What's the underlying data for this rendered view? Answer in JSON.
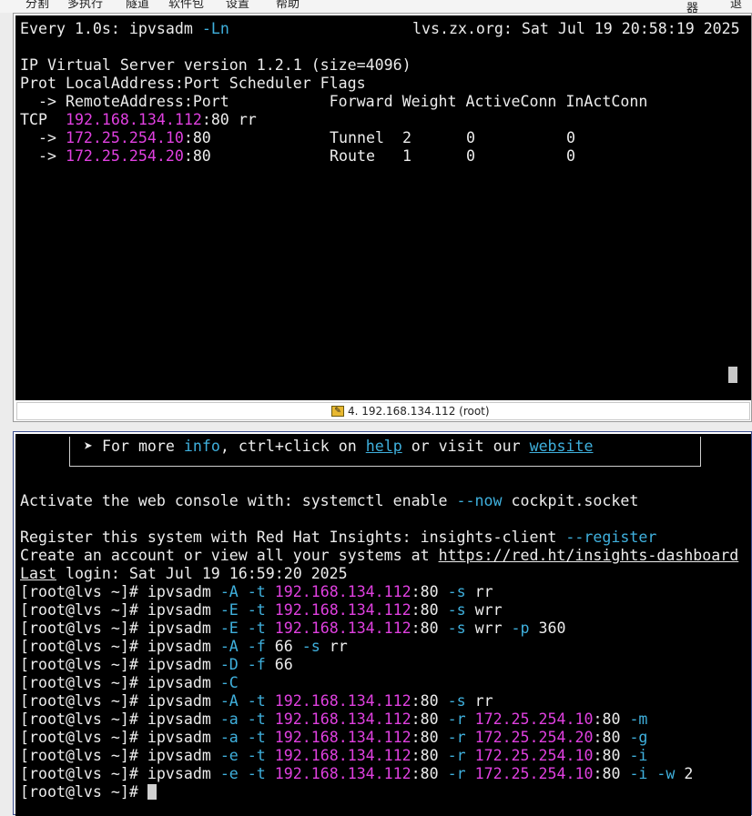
{
  "menubar": {
    "items": [
      "分割",
      "多执行",
      "隧道",
      "软件包",
      "设置",
      "帮助",
      "器",
      "退出"
    ]
  },
  "top_terminal": {
    "watch_header_left": "Every 1.0s: ipvsadm -Ln",
    "watch_cmd": "ipvsadm",
    "watch_flag": "-Ln",
    "watch_interval": "Every 1.0s:",
    "watch_header_right": "lvs.zx.org: Sat Jul 19 20:58:19 2025",
    "version_line": "IP Virtual Server version 1.2.1 (size=4096)",
    "header1": "Prot LocalAddress:Port Scheduler Flags",
    "header2": "  -> RemoteAddress:Port           Forward Weight ActiveConn InActConn",
    "service": {
      "prot": "TCP",
      "ip": "192.168.134.112",
      "port": ":80",
      "scheduler": "rr"
    },
    "real_servers": [
      {
        "arrow": "  -> ",
        "ip": "172.25.254.10",
        "port": ":80",
        "forward": "Tunnel",
        "weight": "2",
        "active": "0",
        "inact": "0"
      },
      {
        "arrow": "  -> ",
        "ip": "172.25.254.20",
        "port": ":80",
        "forward": "Route",
        "weight": "1",
        "active": "0",
        "inact": "0"
      }
    ]
  },
  "tab": {
    "label": "4. 192.168.134.112 (root)"
  },
  "bottom_terminal": {
    "box_line_prefix": "➤ For more ",
    "box_info": "info",
    "box_mid": ", ctrl+click on ",
    "box_help": "help",
    "box_or": " or visit our ",
    "box_website": "website",
    "activate_prefix": "Activate the web console with: systemctl enable ",
    "activate_flag": "--now",
    "activate_suffix": " cockpit.socket",
    "register_prefix": "Register this system with Red Hat Insights: insights-client ",
    "register_flag": "--register",
    "account_prefix": "Create an account or view all your systems at ",
    "account_url": "https://red.ht/insights-dashboard",
    "last_word": "Last",
    "last_rest": " login: Sat Jul 19 16:59:20 2025",
    "prompt": "[root@lvs ~]# ",
    "commands": [
      [
        [
          "k",
          "ipvsadm "
        ],
        [
          "c",
          "-A"
        ],
        [
          "k",
          " "
        ],
        [
          "c",
          "-t"
        ],
        [
          "k",
          " "
        ],
        [
          "m",
          "192.168.134.112"
        ],
        [
          "k",
          ":80 "
        ],
        [
          "c",
          "-s"
        ],
        [
          "k",
          " rr"
        ]
      ],
      [
        [
          "k",
          "ipvsadm "
        ],
        [
          "c",
          "-E"
        ],
        [
          "k",
          " "
        ],
        [
          "c",
          "-t"
        ],
        [
          "k",
          " "
        ],
        [
          "m",
          "192.168.134.112"
        ],
        [
          "k",
          ":80 "
        ],
        [
          "c",
          "-s"
        ],
        [
          "k",
          " wrr"
        ]
      ],
      [
        [
          "k",
          "ipvsadm "
        ],
        [
          "c",
          "-E"
        ],
        [
          "k",
          " "
        ],
        [
          "c",
          "-t"
        ],
        [
          "k",
          " "
        ],
        [
          "m",
          "192.168.134.112"
        ],
        [
          "k",
          ":80 "
        ],
        [
          "c",
          "-s"
        ],
        [
          "k",
          " wrr "
        ],
        [
          "c",
          "-p"
        ],
        [
          "k",
          " 360"
        ]
      ],
      [
        [
          "k",
          "ipvsadm "
        ],
        [
          "c",
          "-A"
        ],
        [
          "k",
          " "
        ],
        [
          "c",
          "-f"
        ],
        [
          "k",
          " 66 "
        ],
        [
          "c",
          "-s"
        ],
        [
          "k",
          " rr"
        ]
      ],
      [
        [
          "k",
          "ipvsadm "
        ],
        [
          "c",
          "-D"
        ],
        [
          "k",
          " "
        ],
        [
          "c",
          "-f"
        ],
        [
          "k",
          " 66"
        ]
      ],
      [
        [
          "k",
          "ipvsadm "
        ],
        [
          "c",
          "-C"
        ]
      ],
      [
        [
          "k",
          "ipvsadm "
        ],
        [
          "c",
          "-A"
        ],
        [
          "k",
          " "
        ],
        [
          "c",
          "-t"
        ],
        [
          "k",
          " "
        ],
        [
          "m",
          "192.168.134.112"
        ],
        [
          "k",
          ":80 "
        ],
        [
          "c",
          "-s"
        ],
        [
          "k",
          " rr"
        ]
      ],
      [
        [
          "k",
          "ipvsadm "
        ],
        [
          "c",
          "-a"
        ],
        [
          "k",
          " "
        ],
        [
          "c",
          "-t"
        ],
        [
          "k",
          " "
        ],
        [
          "m",
          "192.168.134.112"
        ],
        [
          "k",
          ":80 "
        ],
        [
          "c",
          "-r"
        ],
        [
          "k",
          " "
        ],
        [
          "m",
          "172.25.254.10"
        ],
        [
          "k",
          ":80 "
        ],
        [
          "c",
          "-m"
        ]
      ],
      [
        [
          "k",
          "ipvsadm "
        ],
        [
          "c",
          "-a"
        ],
        [
          "k",
          " "
        ],
        [
          "c",
          "-t"
        ],
        [
          "k",
          " "
        ],
        [
          "m",
          "192.168.134.112"
        ],
        [
          "k",
          ":80 "
        ],
        [
          "c",
          "-r"
        ],
        [
          "k",
          " "
        ],
        [
          "m",
          "172.25.254.20"
        ],
        [
          "k",
          ":80 "
        ],
        [
          "c",
          "-g"
        ]
      ],
      [
        [
          "k",
          "ipvsadm "
        ],
        [
          "c",
          "-e"
        ],
        [
          "k",
          " "
        ],
        [
          "c",
          "-t"
        ],
        [
          "k",
          " "
        ],
        [
          "m",
          "192.168.134.112"
        ],
        [
          "k",
          ":80 "
        ],
        [
          "c",
          "-r"
        ],
        [
          "k",
          " "
        ],
        [
          "m",
          "172.25.254.10"
        ],
        [
          "k",
          ":80 "
        ],
        [
          "c",
          "-i"
        ]
      ],
      [
        [
          "k",
          "ipvsadm "
        ],
        [
          "c",
          "-e"
        ],
        [
          "k",
          " "
        ],
        [
          "c",
          "-t"
        ],
        [
          "k",
          " "
        ],
        [
          "m",
          "192.168.134.112"
        ],
        [
          "k",
          ":80 "
        ],
        [
          "c",
          "-r"
        ],
        [
          "k",
          " "
        ],
        [
          "m",
          "172.25.254.10"
        ],
        [
          "k",
          ":80 "
        ],
        [
          "c",
          "-i"
        ],
        [
          "k",
          " "
        ],
        [
          "c",
          "-w"
        ],
        [
          "k",
          " 2"
        ]
      ]
    ]
  },
  "colors": {
    "terminal_bg": "#000000",
    "text": "#ececec",
    "option": "#3fb0dd",
    "ip": "#e040e0"
  }
}
